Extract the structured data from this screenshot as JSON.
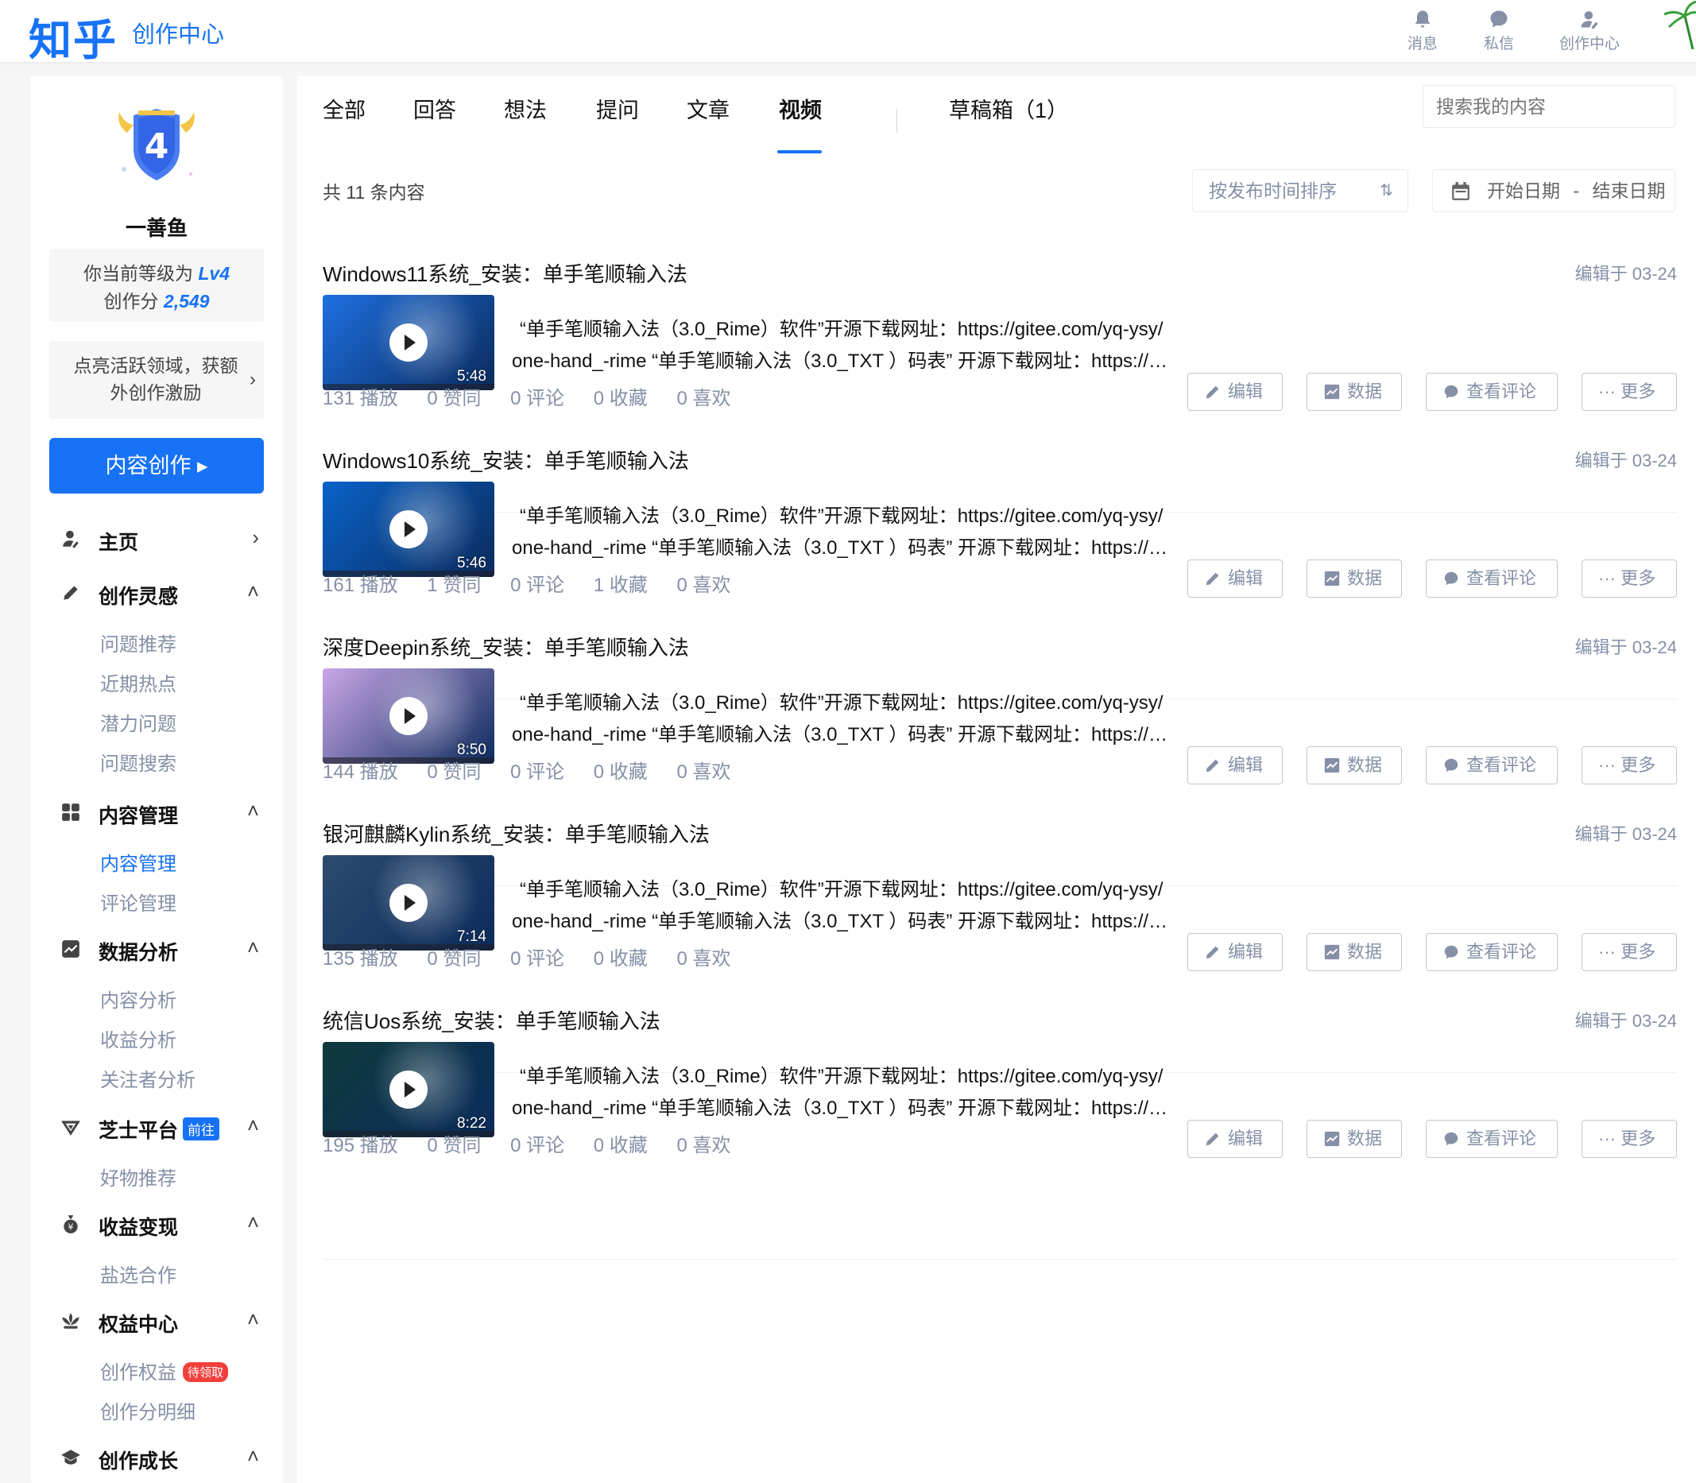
{
  "header": {
    "logo": "知乎",
    "subtitle": "创作中心",
    "icons": [
      {
        "name": "bell-icon",
        "label": "消息"
      },
      {
        "name": "chat-icon",
        "label": "私信"
      },
      {
        "name": "creator-icon",
        "label": "创作中心"
      }
    ]
  },
  "profile": {
    "level_number": "4",
    "name": "一善鱼",
    "level_prefix": "你当前等级为",
    "level": "Lv4",
    "score_prefix": "创作分",
    "score": "2,549",
    "incentive": "点亮活跃领域，获额外创作激励",
    "create_button": "内容创作 ▸"
  },
  "nav": {
    "home": "主页",
    "inspiration": "创作灵感",
    "inspiration_items": [
      "问题推荐",
      "近期热点",
      "潜力问题",
      "问题搜索"
    ],
    "content_mgmt": "内容管理",
    "content_items": [
      "内容管理",
      "评论管理"
    ],
    "analytics": "数据分析",
    "analytics_items": [
      "内容分析",
      "收益分析",
      "关注者分析"
    ],
    "zhishi": "芝士平台",
    "zhishi_tag": "前往",
    "zhishi_items": [
      "好物推荐"
    ],
    "monetize": "收益变现",
    "monetize_items": [
      "盐选合作"
    ],
    "rights": "权益中心",
    "rights_items": [
      "创作权益",
      "创作分明细"
    ],
    "rights_tag": "待领取",
    "growth": "创作成长"
  },
  "tabs": {
    "all": "全部",
    "answers": "回答",
    "thoughts": "想法",
    "questions": "提问",
    "articles": "文章",
    "videos": "视频",
    "drafts": "草稿箱（1）"
  },
  "search_placeholder": "搜索我的内容",
  "count": "共 11 条内容",
  "sort": "按发布时间排序",
  "date_start": "开始日期",
  "date_sep": "-",
  "date_end": "结束日期",
  "buttons": {
    "edit": "编辑",
    "data": "数据",
    "comments": "查看评论",
    "more": "··· 更多"
  },
  "items": [
    {
      "title": "Windows11系统_安装：单手笔顺输入法",
      "date": "编辑于 03-24",
      "duration": "5:48",
      "desc1": "“单手笔顺输入法（3.0_Rime）软件”开源下载网址：https://gitee.com/yq-ysy/",
      "desc2": "one-hand_-rime “单手笔顺输入法（3.0_TXT ）码表” 开源下载网址：https://…",
      "plays": "131 播放",
      "likes": "0 赞同",
      "comments": "0 评论",
      "favs": "0 收藏",
      "hearts": "0 喜欢",
      "thumb_color": "#1d6fe0"
    },
    {
      "title": "Windows10系统_安装：单手笔顺输入法",
      "date": "编辑于 03-24",
      "duration": "5:46",
      "desc1": "“单手笔顺输入法（3.0_Rime）软件”开源下载网址：https://gitee.com/yq-ysy/",
      "desc2": "one-hand_-rime “单手笔顺输入法（3.0_TXT ）码表” 开源下载网址：https://…",
      "plays": "161 播放",
      "likes": "1 赞同",
      "comments": "0 评论",
      "favs": "1 收藏",
      "hearts": "0 喜欢",
      "thumb_color": "#0a62c8"
    },
    {
      "title": "深度Deepin系统_安装：单手笔顺输入法",
      "date": "编辑于 03-24",
      "duration": "8:50",
      "desc1": "“单手笔顺输入法（3.0_Rime）软件”开源下载网址：https://gitee.com/yq-ysy/",
      "desc2": "one-hand_-rime “单手笔顺输入法（3.0_TXT ）码表” 开源下载网址：https://…",
      "plays": "144 播放",
      "likes": "0 赞同",
      "comments": "0 评论",
      "favs": "0 收藏",
      "hearts": "0 喜欢",
      "thumb_color": "#c9a7e8"
    },
    {
      "title": "银河麒麟Kylin系统_安装：单手笔顺输入法",
      "date": "编辑于 03-24",
      "duration": "7:14",
      "desc1": "“单手笔顺输入法（3.0_Rime）软件”开源下载网址：https://gitee.com/yq-ysy/",
      "desc2": "one-hand_-rime “单手笔顺输入法（3.0_TXT ）码表” 开源下载网址：https://…",
      "plays": "135 播放",
      "likes": "0 赞同",
      "comments": "0 评论",
      "favs": "0 收藏",
      "hearts": "0 喜欢",
      "thumb_color": "#2d4b6e"
    },
    {
      "title": "统信Uos系统_安装：单手笔顺输入法",
      "date": "编辑于 03-24",
      "duration": "8:22",
      "desc1": "“单手笔顺输入法（3.0_Rime）软件”开源下载网址：https://gitee.com/yq-ysy/",
      "desc2": "one-hand_-rime “单手笔顺输入法（3.0_TXT ）码表” 开源下载网址：https://…",
      "plays": "195 播放",
      "likes": "0 赞同",
      "comments": "0 评论",
      "favs": "0 收藏",
      "hearts": "0 喜欢",
      "thumb_color": "#0e3a3c"
    }
  ]
}
